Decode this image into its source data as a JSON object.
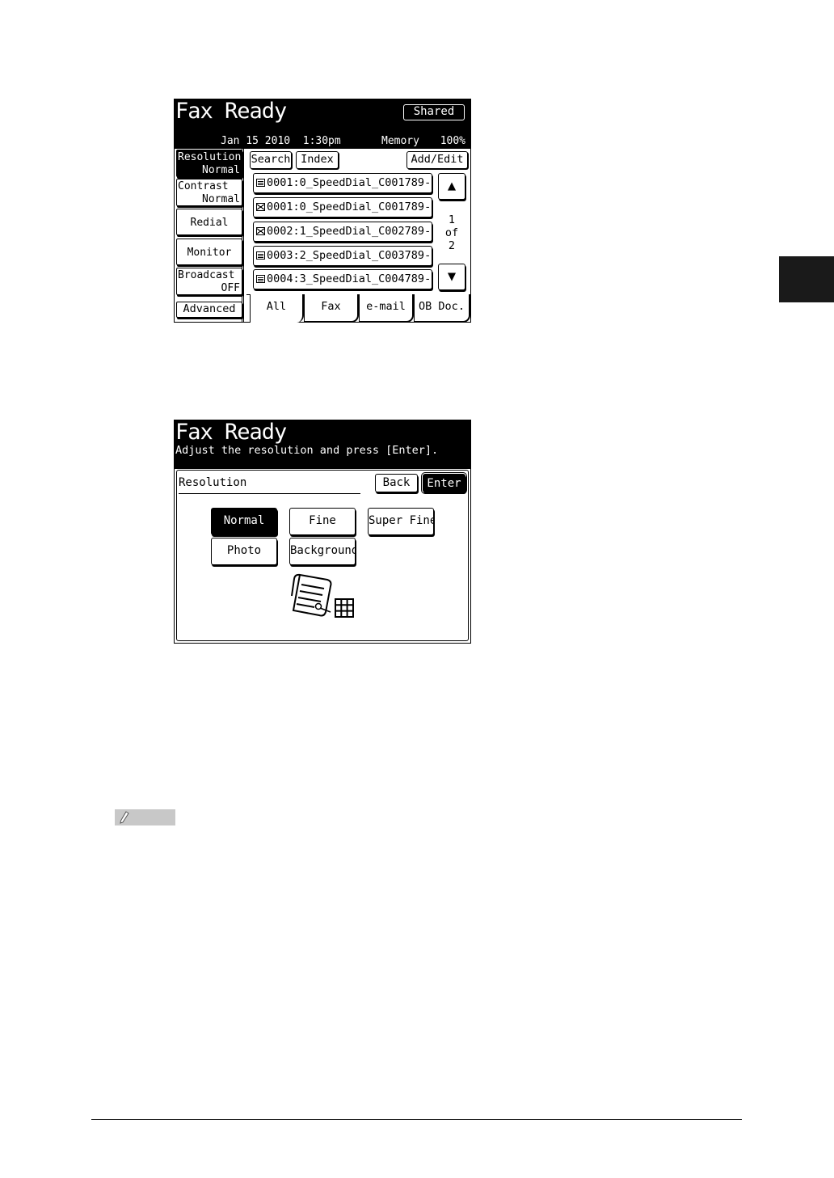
{
  "screen1": {
    "title": "Fax Ready",
    "shared_label": "Shared",
    "status": {
      "date": "Jan 15 2010",
      "time": "1:30pm",
      "memory_label": "Memory",
      "memory_value": "100%"
    },
    "side_buttons": {
      "resolution": {
        "label": "Resolution",
        "value": "Normal"
      },
      "contrast": {
        "label": "Contrast",
        "value": "Normal"
      },
      "redial": {
        "label": "Redial"
      },
      "monitor": {
        "label": "Monitor"
      },
      "broadcast": {
        "label": "Broadcast",
        "value": "OFF"
      },
      "advanced": {
        "label": "Advanced"
      }
    },
    "toolbar": {
      "search": "Search",
      "index": "Index",
      "add_edit": "Add/Edit"
    },
    "list": [
      {
        "icon": "fax-icon",
        "text": "0001:0_SpeedDial_C001789-"
      },
      {
        "icon": "email-icon",
        "text": "0001:0_SpeedDial_C001789-"
      },
      {
        "icon": "email-icon",
        "text": "0002:1_SpeedDial_C002789-"
      },
      {
        "icon": "fax-icon",
        "text": "0003:2_SpeedDial_C003789-"
      },
      {
        "icon": "fax-icon",
        "text": "0004:3_SpeedDial_C004789-"
      }
    ],
    "pager": {
      "up": "▲",
      "down": "▼",
      "current": "1",
      "of": "of",
      "total": "2"
    },
    "tabs": [
      "All",
      "Fax",
      "e-mail",
      "OB Doc."
    ]
  },
  "screen2": {
    "title": "Fax Ready",
    "subtitle": "Adjust the resolution and press [Enter].",
    "section_label": "Resolution",
    "back_label": "Back",
    "enter_label": "Enter",
    "options": [
      {
        "label": "Normal",
        "selected": true
      },
      {
        "label": "Fine",
        "selected": false
      },
      {
        "label": "Super Fine",
        "selected": false
      },
      {
        "label": "Photo",
        "selected": false
      },
      {
        "label": "Background",
        "selected": false
      }
    ],
    "icon": "fax-resolution-icon"
  },
  "page": {
    "note_icon": "pencil-icon"
  }
}
